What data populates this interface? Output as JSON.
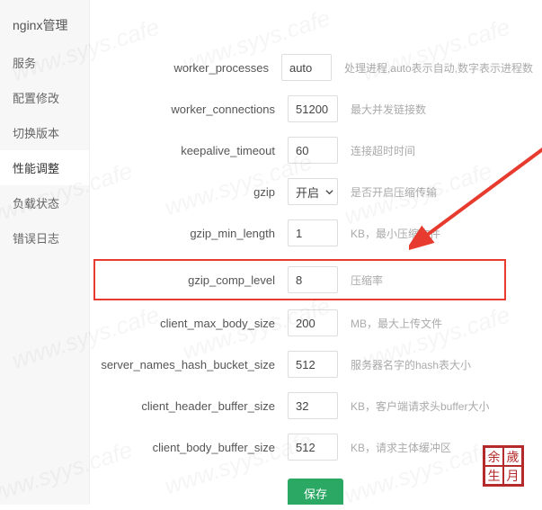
{
  "sidebar": {
    "title": "nginx管理",
    "items": [
      {
        "label": "服务"
      },
      {
        "label": "配置修改"
      },
      {
        "label": "切换版本"
      },
      {
        "label": "性能调整",
        "active": true
      },
      {
        "label": "负载状态"
      },
      {
        "label": "错误日志"
      }
    ]
  },
  "form": {
    "worker_processes": {
      "label": "worker_processes",
      "value": "auto",
      "hint": "处理进程,auto表示自动,数字表示进程数"
    },
    "worker_connections": {
      "label": "worker_connections",
      "value": "51200",
      "hint": "最大并发链接数"
    },
    "keepalive_timeout": {
      "label": "keepalive_timeout",
      "value": "60",
      "hint": "连接超时时间"
    },
    "gzip": {
      "label": "gzip",
      "value": "开启",
      "hint": "是否开启压缩传输"
    },
    "gzip_min_length": {
      "label": "gzip_min_length",
      "value": "1",
      "hint": "KB，最小压缩文件"
    },
    "gzip_comp_level": {
      "label": "gzip_comp_level",
      "value": "8",
      "hint": "压缩率"
    },
    "client_max_body_size": {
      "label": "client_max_body_size",
      "value": "200",
      "hint": "MB，最大上传文件"
    },
    "server_names_hash_bucket_size": {
      "label": "server_names_hash_bucket_size",
      "value": "512",
      "hint": "服务器名字的hash表大小"
    },
    "client_header_buffer_size": {
      "label": "client_header_buffer_size",
      "value": "32",
      "hint": "KB，客户端请求头buffer大小"
    },
    "client_body_buffer_size": {
      "label": "client_body_buffer_size",
      "value": "512",
      "hint": "KB，请求主体缓冲区"
    }
  },
  "actions": {
    "save": "保存"
  },
  "watermark": "www.syys.cafe",
  "seal": [
    "余",
    "歲",
    "生",
    "月"
  ]
}
